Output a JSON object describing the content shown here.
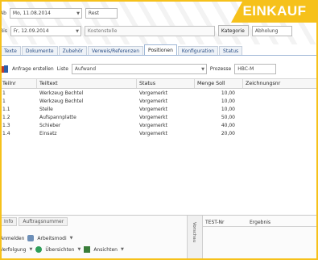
{
  "badge": {
    "text": "EINKAUF"
  },
  "top": {
    "row1": {
      "label": "Ab",
      "date_value": "Mo, 11.08.2014",
      "period_value": "Rest"
    },
    "row2": {
      "label": "Bis",
      "date_value": "Fr, 12.09.2014",
      "field_placeholder": "Kostenstelle",
      "category_label": "Kategorie",
      "category_value": "Abholung"
    }
  },
  "tabs": [
    {
      "label": "Texte"
    },
    {
      "label": "Dokumente"
    },
    {
      "label": "Zubehör"
    },
    {
      "label": "Verweis/Referenzen"
    },
    {
      "label": "Positionen"
    },
    {
      "label": "Konfiguration"
    },
    {
      "label": "Status"
    }
  ],
  "toolbar": {
    "add_label": "Anfrage erstellen",
    "list_label": "Liste",
    "list_value": "Aufwand",
    "process_label": "Prozesse",
    "process_value": "HBC-M"
  },
  "grid": {
    "columns": [
      "Teilnr",
      "Teiltext",
      "Status",
      "Menge Soll",
      "Zeichnungsnr"
    ],
    "rows": [
      {
        "nr": "1",
        "text": "Werkzeug Bechtel",
        "status": "Vorgemerkt",
        "qty": "10,00",
        "drawing": ""
      },
      {
        "nr": "1",
        "text": "Werkzeug Bechtel",
        "status": "Vorgemerkt",
        "qty": "10,00",
        "drawing": ""
      },
      {
        "nr": "1.1",
        "text": "Stelle",
        "status": "Vorgemerkt",
        "qty": "10,00",
        "drawing": ""
      },
      {
        "nr": "1.2",
        "text": "Aufspannplatte",
        "status": "Vorgemerkt",
        "qty": "50,00",
        "drawing": ""
      },
      {
        "nr": "1.3",
        "text": "Schieber",
        "status": "Vorgemerkt",
        "qty": "40,00",
        "drawing": ""
      },
      {
        "nr": "1.4",
        "text": "Einsatz",
        "status": "Vorgemerkt",
        "qty": "20,00",
        "drawing": ""
      }
    ]
  },
  "bottom": {
    "tabs": [
      "Info",
      "Auftragsnummer"
    ],
    "line1": {
      "prefix": "Anmelden",
      "link": "Arbeitsmodi"
    },
    "line2": {
      "prefix": "Verfolgung",
      "item1": "Übersichten",
      "item2": "Ansichten"
    },
    "splitter_text": "Vorschau",
    "right_columns": [
      "TEST-Nr",
      "Ergebnis"
    ]
  },
  "colors": {
    "accent": "#f6c11b",
    "tab_text": "#2b4f86"
  }
}
